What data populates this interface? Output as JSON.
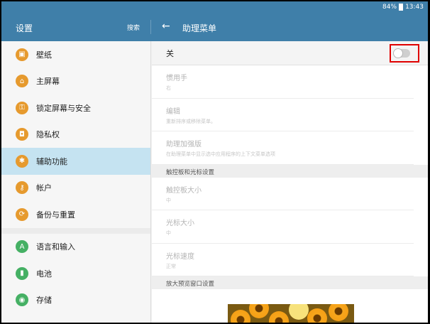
{
  "status": {
    "battery_percent": "84%",
    "time": "13:43"
  },
  "header": {
    "left_title": "设置",
    "search_label": "搜索",
    "back_icon": "arrow-left-icon",
    "right_title": "助理菜单"
  },
  "sidebar": {
    "groups": [
      [
        {
          "label": "壁纸",
          "icon": "wallpaper-icon",
          "glyph": "▣"
        },
        {
          "label": "主屏幕",
          "icon": "home-icon",
          "glyph": "⌂"
        },
        {
          "label": "锁定屏幕与安全",
          "icon": "lock-icon",
          "glyph": "⚿"
        },
        {
          "label": "隐私权",
          "icon": "privacy-icon",
          "glyph": "◘"
        },
        {
          "label": "辅助功能",
          "icon": "accessibility-icon",
          "glyph": "✱",
          "active": true
        },
        {
          "label": "帐户",
          "icon": "key-icon",
          "glyph": "⚷"
        },
        {
          "label": "备份与重置",
          "icon": "backup-icon",
          "glyph": "⟳"
        }
      ],
      [
        {
          "label": "语言和输入",
          "icon": "language-icon",
          "glyph": "A",
          "color": "green"
        },
        {
          "label": "电池",
          "icon": "battery-icon",
          "glyph": "▮",
          "color": "green"
        },
        {
          "label": "存储",
          "icon": "storage-icon",
          "glyph": "◉",
          "color": "green"
        }
      ]
    ]
  },
  "main": {
    "toggle_label": "关",
    "toggle_on": false,
    "items": [
      {
        "title": "惯用手",
        "sub": "右"
      },
      {
        "title": "编辑",
        "sub": "重新排序或移除菜单。"
      },
      {
        "title": "助理加强版",
        "sub": "在助理菜单中显示选中应用程序的上下文菜单选项"
      }
    ],
    "section1": "触控板和光标设置",
    "items2": [
      {
        "title": "触控板大小",
        "sub": "中"
      },
      {
        "title": "光标大小",
        "sub": "中"
      },
      {
        "title": "光标速度",
        "sub": "正常"
      }
    ],
    "section2": "放大预览窗口设置"
  },
  "colors": {
    "accent": "#3f7fa9",
    "icon_orange": "#e69a2e",
    "icon_green": "#45b064",
    "active_bg": "#c5e3f1"
  }
}
